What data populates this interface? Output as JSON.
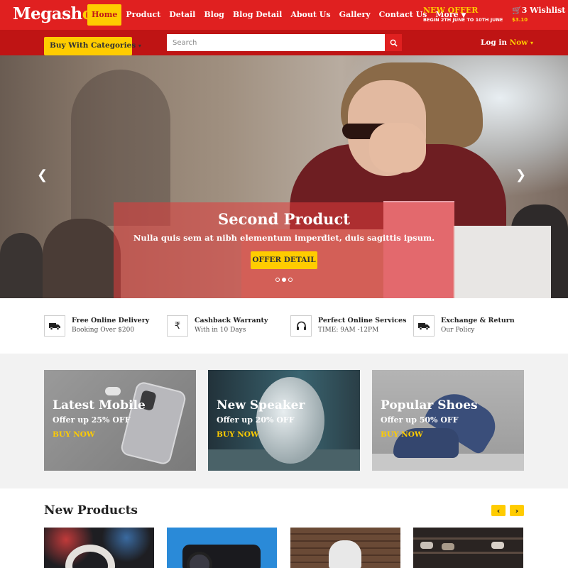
{
  "header": {
    "logo_main": "Megash",
    "logo_accent": "op",
    "nav": [
      {
        "label": "Home",
        "active": true
      },
      {
        "label": "Product"
      },
      {
        "label": "Detail"
      },
      {
        "label": "Blog"
      },
      {
        "label": "Blog Detail"
      },
      {
        "label": "About Us"
      },
      {
        "label": "Gallery"
      },
      {
        "label": "Contact Us"
      },
      {
        "label": "More"
      }
    ],
    "offer_title": "NEW OFFER",
    "offer_dates": "BEGIN 2TH JUNE TO 10TH JUNE",
    "wishlist_label": "3 Wishlist",
    "wishlist_price": "$3.10"
  },
  "subbar": {
    "category_button": "Buy With Categories",
    "search_placeholder": "Search",
    "login_text": "Log in",
    "login_accent": "Now"
  },
  "hero": {
    "title": "Second Product",
    "subtitle": "Nulla quis sem at nibh elementum imperdiet, duis sagittis ipsum.",
    "button": "OFFER DETAIL",
    "slides": 3,
    "active_slide": 2
  },
  "features": [
    {
      "icon": "truck-icon",
      "title": "Free Online Delivery",
      "subtitle": "Booking Over $200"
    },
    {
      "icon": "rupee-icon",
      "title": "Cashback Warranty",
      "subtitle": "With in 10 Days"
    },
    {
      "icon": "headphones-icon",
      "title": "Perfect Online Services",
      "subtitle": "TIME: 9AM -12PM"
    },
    {
      "icon": "truck-icon",
      "title": "Exchange & Return",
      "subtitle": "Our Policy"
    }
  ],
  "promos": [
    {
      "title": "Latest Mobile",
      "offer": "Offer up 25% OFF",
      "cta": "BUY NOW"
    },
    {
      "title": "New Speaker",
      "offer": "Offer up 20% OFF",
      "cta": "BUY NOW"
    },
    {
      "title": "Popular Shoes",
      "offer": "Offer up 50% OFF",
      "cta": "BUY NOW"
    }
  ],
  "new_products": {
    "title": "New Products"
  },
  "colors": {
    "primary_red": "#e02020",
    "dark_red": "#bf1414",
    "accent_yellow": "#ffcc00"
  }
}
